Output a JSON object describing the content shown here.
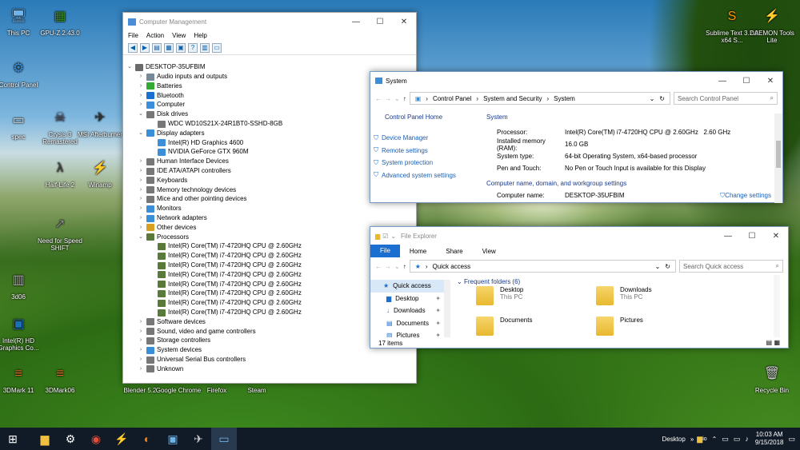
{
  "desktop": {
    "icons": [
      {
        "label": "This PC",
        "glyph": "🖥",
        "color": "#6fb3e8"
      },
      {
        "label": "GPU-Z 2.43.0",
        "glyph": "▦",
        "color": "#3c8a2e"
      },
      {
        "label": "Control Panel",
        "glyph": "⚙",
        "color": "#3a8fd8"
      },
      {
        "label": "spec",
        "glyph": "▭",
        "color": "#ddd"
      },
      {
        "label": "Crysis 3 Remastered",
        "glyph": "☠",
        "color": "#556"
      },
      {
        "label": "MSI Afterburner",
        "glyph": "✈",
        "color": "#333"
      },
      {
        "label": "Half-Life 2",
        "glyph": "λ",
        "color": "#444"
      },
      {
        "label": "Winamp",
        "glyph": "⚡",
        "color": "#f0a020"
      },
      {
        "label": "Need for Speed SHIFT",
        "glyph": "↗",
        "color": "#888"
      },
      {
        "label": "3d06",
        "glyph": "▥",
        "color": "#aaa"
      },
      {
        "label": "Intel(R) HD Graphics Co...",
        "glyph": "▣",
        "color": "#1b6fb5"
      },
      {
        "label": "3DMark 11",
        "glyph": "≡",
        "color": "#e07020"
      },
      {
        "label": "3DMark06",
        "glyph": "≡",
        "color": "#e07020"
      },
      {
        "label": "Blender 5.2",
        "glyph": "◉",
        "color": "#e87d0d"
      },
      {
        "label": "Google Chrome",
        "glyph": "◎",
        "color": "#4285f4"
      },
      {
        "label": "Firefox",
        "glyph": "◐",
        "color": "#e66000"
      },
      {
        "label": "Steam",
        "glyph": "◍",
        "color": "#1b2838"
      },
      {
        "label": "Sublime Text 3.2.2 x64 S...",
        "glyph": "S",
        "color": "#ff9800"
      },
      {
        "label": "DAEMON Tools Lite",
        "glyph": "⚡",
        "color": "#1e88e5"
      },
      {
        "label": "Recycle Bin",
        "glyph": "🗑",
        "color": "#ccc"
      }
    ]
  },
  "cm": {
    "title": "Computer Management",
    "menu": [
      "File",
      "Action",
      "View",
      "Help"
    ],
    "root": "DESKTOP-35UFBIM",
    "nodes": [
      {
        "label": "Audio inputs and outputs",
        "ar": "›",
        "indent": 1,
        "color": "#789"
      },
      {
        "label": "Batteries",
        "ar": "›",
        "indent": 1,
        "color": "#3a3"
      },
      {
        "label": "Bluetooth",
        "ar": "›",
        "indent": 1,
        "color": "#1a6fd0"
      },
      {
        "label": "Computer",
        "ar": "›",
        "indent": 1,
        "color": "#3a8fd8"
      },
      {
        "label": "Disk drives",
        "ar": "⌄",
        "indent": 1,
        "color": "#777"
      },
      {
        "label": "WDC WD10S21X-24R1BT0-SSHD-8GB",
        "ar": "",
        "indent": 2,
        "color": "#777"
      },
      {
        "label": "Display adapters",
        "ar": "⌄",
        "indent": 1,
        "color": "#3a8fd8"
      },
      {
        "label": "Intel(R) HD Graphics 4600",
        "ar": "",
        "indent": 2,
        "color": "#3a8fd8"
      },
      {
        "label": "NVIDIA GeForce GTX 960M",
        "ar": "",
        "indent": 2,
        "color": "#3a8fd8"
      },
      {
        "label": "Human Interface Devices",
        "ar": "›",
        "indent": 1,
        "color": "#777"
      },
      {
        "label": "IDE ATA/ATAPI controllers",
        "ar": "›",
        "indent": 1,
        "color": "#777"
      },
      {
        "label": "Keyboards",
        "ar": "›",
        "indent": 1,
        "color": "#777"
      },
      {
        "label": "Memory technology devices",
        "ar": "›",
        "indent": 1,
        "color": "#777"
      },
      {
        "label": "Mice and other pointing devices",
        "ar": "›",
        "indent": 1,
        "color": "#777"
      },
      {
        "label": "Monitors",
        "ar": "›",
        "indent": 1,
        "color": "#3a8fd8"
      },
      {
        "label": "Network adapters",
        "ar": "›",
        "indent": 1,
        "color": "#3a8fd8"
      },
      {
        "label": "Other devices",
        "ar": "›",
        "indent": 1,
        "color": "#d8a020"
      },
      {
        "label": "Processors",
        "ar": "⌄",
        "indent": 1,
        "color": "#5a7a3a"
      },
      {
        "label": "Intel(R) Core(TM) i7-4720HQ CPU @ 2.60GHz",
        "ar": "",
        "indent": 2,
        "color": "#5a7a3a"
      },
      {
        "label": "Intel(R) Core(TM) i7-4720HQ CPU @ 2.60GHz",
        "ar": "",
        "indent": 2,
        "color": "#5a7a3a"
      },
      {
        "label": "Intel(R) Core(TM) i7-4720HQ CPU @ 2.60GHz",
        "ar": "",
        "indent": 2,
        "color": "#5a7a3a"
      },
      {
        "label": "Intel(R) Core(TM) i7-4720HQ CPU @ 2.60GHz",
        "ar": "",
        "indent": 2,
        "color": "#5a7a3a"
      },
      {
        "label": "Intel(R) Core(TM) i7-4720HQ CPU @ 2.60GHz",
        "ar": "",
        "indent": 2,
        "color": "#5a7a3a"
      },
      {
        "label": "Intel(R) Core(TM) i7-4720HQ CPU @ 2.60GHz",
        "ar": "",
        "indent": 2,
        "color": "#5a7a3a"
      },
      {
        "label": "Intel(R) Core(TM) i7-4720HQ CPU @ 2.60GHz",
        "ar": "",
        "indent": 2,
        "color": "#5a7a3a"
      },
      {
        "label": "Intel(R) Core(TM) i7-4720HQ CPU @ 2.60GHz",
        "ar": "",
        "indent": 2,
        "color": "#5a7a3a"
      },
      {
        "label": "Software devices",
        "ar": "›",
        "indent": 1,
        "color": "#777"
      },
      {
        "label": "Sound, video and game controllers",
        "ar": "›",
        "indent": 1,
        "color": "#777"
      },
      {
        "label": "Storage controllers",
        "ar": "›",
        "indent": 1,
        "color": "#777"
      },
      {
        "label": "System devices",
        "ar": "›",
        "indent": 1,
        "color": "#3a8fd8"
      },
      {
        "label": "Universal Serial Bus controllers",
        "ar": "›",
        "indent": 1,
        "color": "#777"
      },
      {
        "label": "Unknown",
        "ar": "›",
        "indent": 1,
        "color": "#777"
      }
    ]
  },
  "sys": {
    "title": "System",
    "crumbs": [
      "Control Panel",
      "System and Security",
      "System"
    ],
    "search_placeholder": "Search Control Panel",
    "home": "Control Panel Home",
    "links": [
      "Device Manager",
      "Remote settings",
      "System protection",
      "Advanced system settings"
    ],
    "section": "System",
    "rows": [
      {
        "k": "Processor:",
        "v": "Intel(R) Core(TM) i7-4720HQ CPU @ 2.60GHz   2.60 GHz"
      },
      {
        "k": "Installed memory (RAM):",
        "v": "16.0 GB"
      },
      {
        "k": "System type:",
        "v": "64-bit Operating System, x64-based processor"
      },
      {
        "k": "Pen and Touch:",
        "v": "No Pen or Touch Input is available for this Display"
      }
    ],
    "section2": "Computer name, domain, and workgroup settings",
    "name_k": "Computer name:",
    "name_v": "DESKTOP-35UFBIM",
    "change": "Change settings"
  },
  "fe": {
    "title": "File Explorer",
    "tabs": [
      "File",
      "Home",
      "Share",
      "View"
    ],
    "addr": "Quick access",
    "search_placeholder": "Search Quick access",
    "nav": [
      "Quick access",
      "Desktop",
      "Downloads",
      "Documents",
      "Pictures"
    ],
    "group": "Frequent folders (6)",
    "folders": [
      {
        "name": "Desktop",
        "sub": "This PC"
      },
      {
        "name": "Downloads",
        "sub": "This PC"
      },
      {
        "name": "Documents",
        "sub": ""
      },
      {
        "name": "Pictures",
        "sub": ""
      }
    ],
    "status": "17 items"
  },
  "taskbar": {
    "desktop_label": "Desktop",
    "time": "10:03 AM",
    "date": "9/15/2018",
    "tray_text": "io"
  }
}
